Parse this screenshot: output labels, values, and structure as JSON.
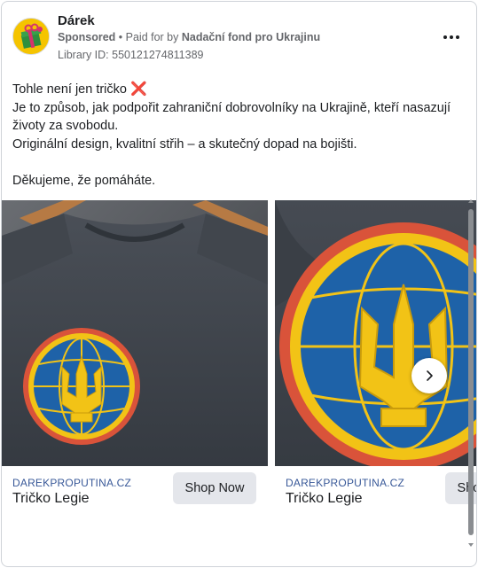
{
  "ad": {
    "page_name": "Dárek",
    "sponsored_label": "Sponsored",
    "separator": " • ",
    "paid_for_prefix": "Paid for by ",
    "funder": "Nadační fond pro Ukrajinu",
    "library_id": "Library ID: 550121274811389"
  },
  "body": {
    "line1_text": "Tohle není jen tričko ",
    "line1_emoji": "❌",
    "line2": "Je to způsob, jak podpořit zahraniční dobrovolníky na Ukrajině, kteří nasazují životy za svobodu.",
    "line3": "Originální design, kvalitní střih – a skutečný dopad na bojišti.",
    "line4": "",
    "line5": "Děkujeme, že pomáháte."
  },
  "carousel": {
    "cards": [
      {
        "domain": "DAREKPROPUTINA.CZ",
        "title": "Tričko Legie",
        "cta": "Shop Now"
      },
      {
        "domain": "DAREKPROPUTINA.CZ",
        "title": "Tričko Legie",
        "cta": "Shop Now"
      }
    ]
  },
  "icons": {
    "more": "more-horizontal-icon",
    "next": "chevron-right-icon",
    "avatar": "gift-icon"
  },
  "colors": {
    "domain_link": "#385898",
    "cta_bg": "#e4e6eb",
    "shirt": "#3f444b",
    "emblem_blue": "#1e62a8",
    "emblem_yellow": "#f2c316",
    "emblem_ring": "#d9533a"
  }
}
